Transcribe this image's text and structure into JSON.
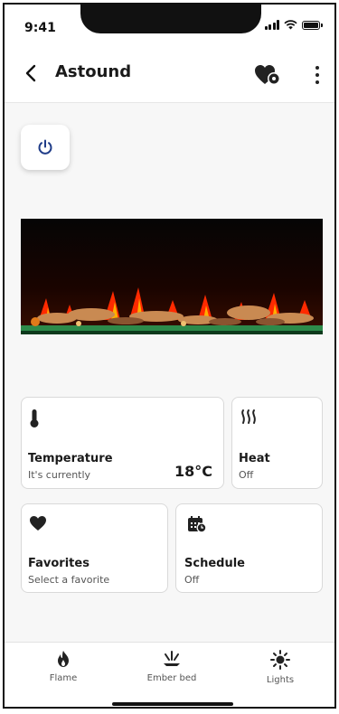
{
  "status_bar": {
    "time": "9:41"
  },
  "header": {
    "title": "Astound"
  },
  "cards": {
    "temperature": {
      "label": "Temperature",
      "sub": "It's currently",
      "value": "18°C"
    },
    "heat": {
      "label": "Heat",
      "sub": "Off"
    },
    "favorites": {
      "label": "Favorites",
      "sub": "Select a favorite"
    },
    "schedule": {
      "label": "Schedule",
      "sub": "Off"
    }
  },
  "tabs": [
    {
      "label": "Flame",
      "icon": "flame-icon"
    },
    {
      "label": "Ember bed",
      "icon": "ember-icon"
    },
    {
      "label": "Lights",
      "icon": "light-icon"
    }
  ],
  "colors": {
    "accent": "#1f3c88",
    "text": "#1a1a1a",
    "border": "#d9d9d9"
  }
}
